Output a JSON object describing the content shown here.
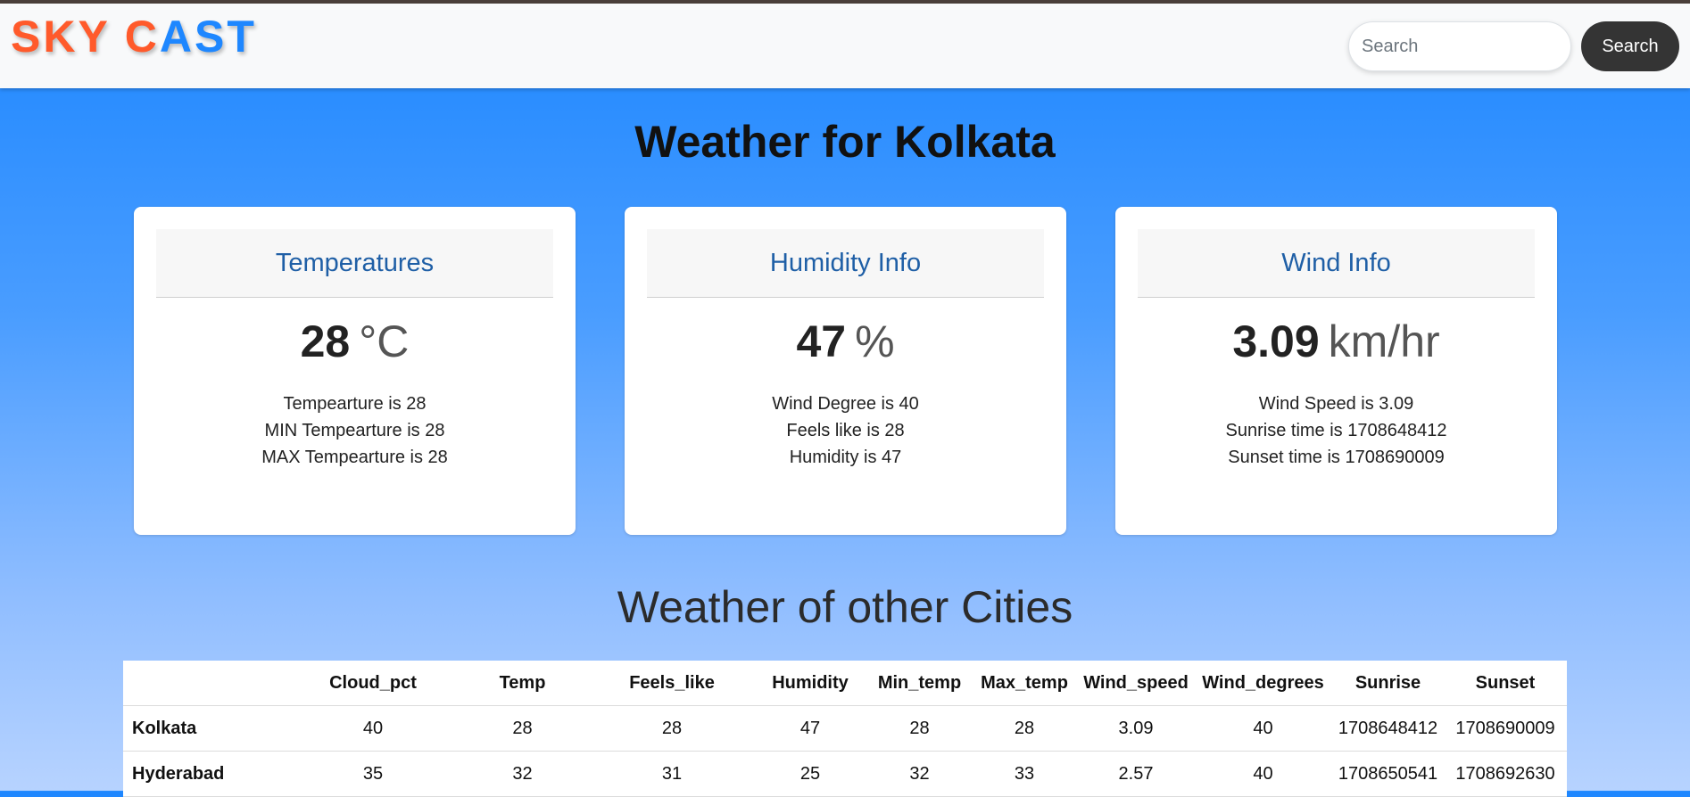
{
  "brand": {
    "part1": "SKY ",
    "part2a": "C",
    "part2b": "AST"
  },
  "search": {
    "placeholder": "Search",
    "button_label": "Search"
  },
  "title": "Weather for Kolkata",
  "cards": [
    {
      "header": "Temperatures",
      "value": "28",
      "unit": "°C",
      "details": [
        "Tempearture is 28",
        "MIN Tempearture is 28",
        "MAX Tempearture is 28"
      ]
    },
    {
      "header": "Humidity Info",
      "value": "47",
      "unit": "%",
      "details": [
        "Wind Degree is 40",
        "Feels like is 28",
        "Humidity is 47"
      ]
    },
    {
      "header": "Wind Info",
      "value": "3.09",
      "unit": "km/hr",
      "details": [
        "Wind Speed is 3.09",
        "Sunrise time is 1708648412",
        "Sunset time is 1708690009"
      ]
    }
  ],
  "other_cities": {
    "title": "Weather of other Cities",
    "columns": [
      "",
      "Cloud_pct",
      "Temp",
      "Feels_like",
      "Humidity",
      "Min_temp",
      "Max_temp",
      "Wind_speed",
      "Wind_degrees",
      "Sunrise",
      "Sunset"
    ],
    "rows": [
      [
        "Kolkata",
        "40",
        "28",
        "28",
        "47",
        "28",
        "28",
        "3.09",
        "40",
        "1708648412",
        "1708690009"
      ],
      [
        "Hyderabad",
        "35",
        "32",
        "31",
        "25",
        "32",
        "33",
        "2.57",
        "40",
        "1708650541",
        "1708692630"
      ]
    ]
  },
  "colors": {
    "brand_orange": "#ff5a2b",
    "brand_blue": "#1e87ff",
    "card_header_text": "#1f5fa6",
    "search_button_bg": "#343434"
  }
}
